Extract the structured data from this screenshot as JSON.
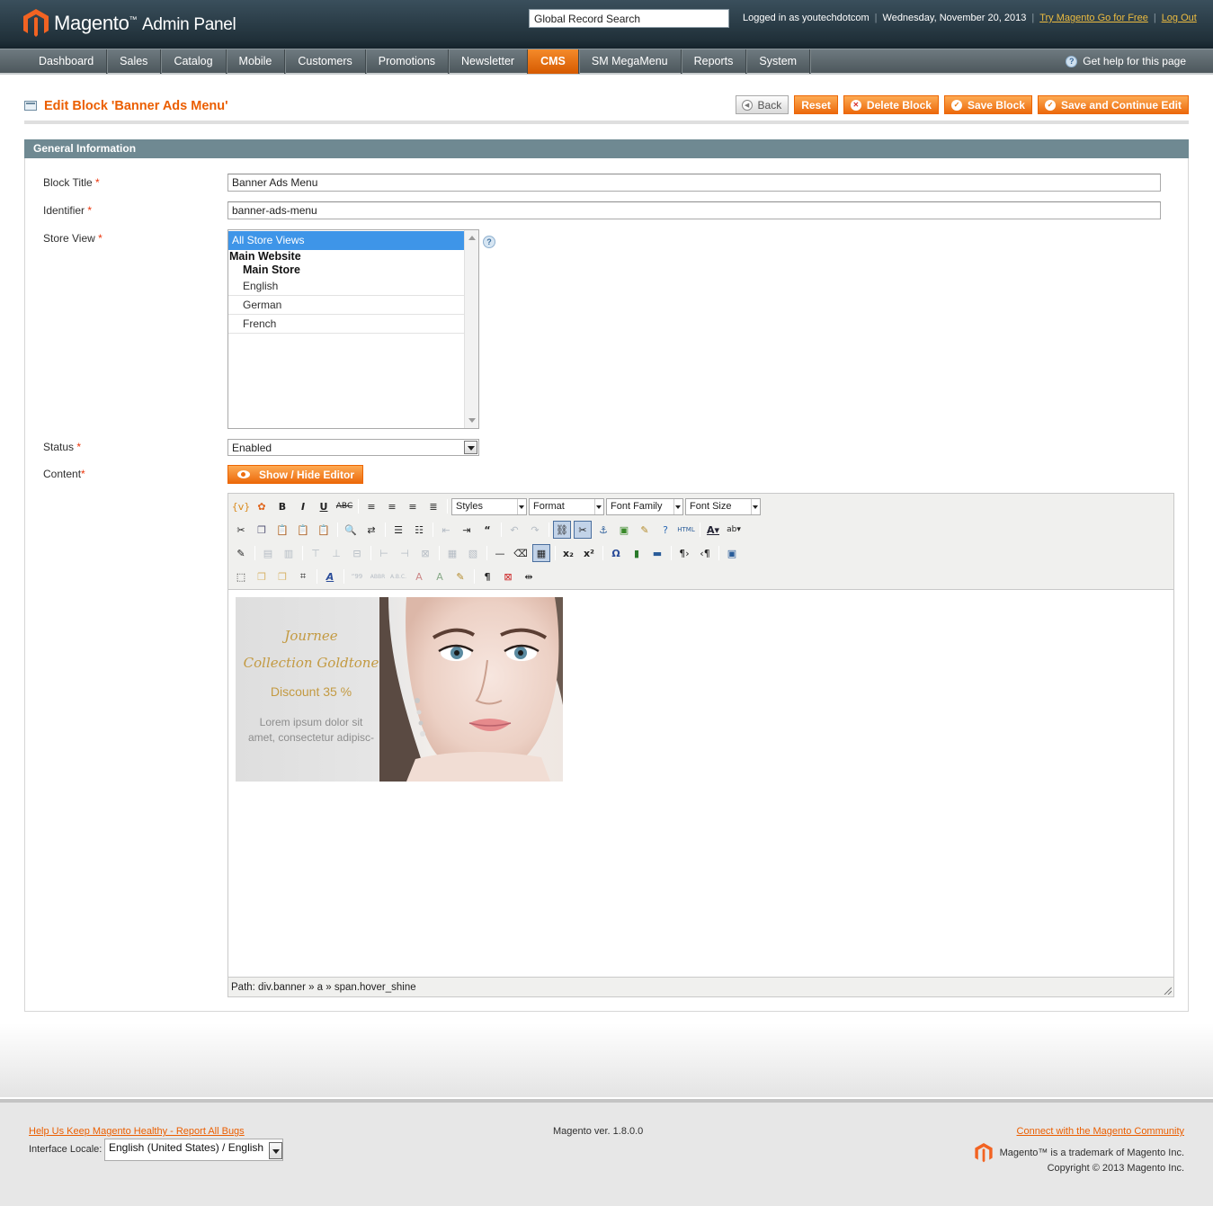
{
  "app": {
    "logo_text": "Magento",
    "logo_tm": "™",
    "logo_sub": "Admin Panel",
    "brand_color": "#eb5e00"
  },
  "header": {
    "search_value": "Global Record Search",
    "logged_in": "Logged in as youtechdotcom",
    "date": "Wednesday, November 20, 2013",
    "try_link": "Try Magento Go for Free",
    "logout_link": "Log Out",
    "separator": "|"
  },
  "nav": {
    "items": [
      {
        "label": "Dashboard"
      },
      {
        "label": "Sales"
      },
      {
        "label": "Catalog"
      },
      {
        "label": "Mobile"
      },
      {
        "label": "Customers"
      },
      {
        "label": "Promotions"
      },
      {
        "label": "Newsletter"
      },
      {
        "label": "CMS"
      },
      {
        "label": "SM MegaMenu"
      },
      {
        "label": "Reports"
      },
      {
        "label": "System"
      }
    ],
    "active": "CMS",
    "help_label": "Get help for this page"
  },
  "page": {
    "title": "Edit Block 'Banner Ads Menu'",
    "buttons": {
      "back": "Back",
      "reset": "Reset",
      "delete": "Delete Block",
      "save": "Save Block",
      "save_continue": "Save and Continue Edit"
    }
  },
  "form": {
    "section_title": "General Information",
    "required_mark": "*",
    "block_title_label": "Block Title",
    "block_title_value": "Banner Ads Menu",
    "identifier_label": "Identifier",
    "identifier_value": "banner-ads-menu",
    "store_view_label": "Store View",
    "store_view": {
      "selected": "All Store Views",
      "website": "Main Website",
      "store": "Main Store",
      "views": [
        "English",
        "German",
        "French"
      ]
    },
    "status_label": "Status",
    "status_value": "Enabled",
    "content_label": "Content",
    "show_hide_label": "Show / Hide Editor"
  },
  "editor": {
    "dropdowns": {
      "styles": "Styles",
      "format": "Format",
      "font_family": "Font Family",
      "font_size": "Font Size"
    },
    "path": "Path: div.banner » a » span.hover_shine",
    "banner": {
      "line1": "Journee",
      "line2": "Collection Goldtone",
      "line3": "Discount  35 %",
      "line4": "Lorem ipsum dolor sit",
      "line5": "amet, consectetur adipisc-"
    }
  },
  "footer": {
    "bugs_link": "Help Us Keep Magento Healthy - Report All Bugs",
    "version": "Magento ver. 1.8.0.0",
    "community_link": "Connect with the Magento Community",
    "locale_label": "Interface Locale:",
    "locale_value": "English (United States) / English",
    "trademark": "Magento™ is a trademark of Magento Inc.",
    "copyright": "Copyright © 2013 Magento Inc."
  }
}
